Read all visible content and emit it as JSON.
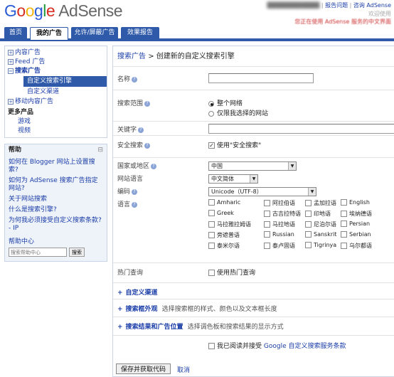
{
  "header": {
    "logo_google": [
      "G",
      "o",
      "o",
      "g",
      "l",
      "e"
    ],
    "logo_product": "AdSense",
    "userbar_account": "████████████",
    "userbar_links": [
      "报告问题",
      "咨询",
      "AdSense"
    ],
    "notice_line1": "欢迎使用",
    "notice_line2": "您正在使用 AdSense 服务的中文界面"
  },
  "tabs": [
    {
      "label": "首页"
    },
    {
      "label": "我的广告"
    },
    {
      "label": "允许/屏蔽广告"
    },
    {
      "label": "效果报告"
    }
  ],
  "sidebar": {
    "nav": [
      {
        "label": "内容广告",
        "icon": "+"
      },
      {
        "label": "Feed 广告",
        "icon": "+"
      },
      {
        "label": "搜索广告",
        "icon": "−"
      }
    ],
    "sub_selected": "自定义搜索引擎",
    "sub_other": "自定义渠道",
    "mobile": {
      "label": "移动内容广告",
      "icon": "+"
    },
    "more_title": "更多产品",
    "more_items": [
      "游戏",
      "视频"
    ],
    "help_title": "帮助",
    "help_min": "⊟",
    "help_links": [
      "如何在 Blogger 网站上设置搜索?",
      "如何为 AdSense 搜索广告指定网站?",
      "关于网站搜索",
      "什么是搜索引擎?",
      "为何我必须接受自定义搜索条款? - IP"
    ],
    "help_center": "帮助中心",
    "help_search_placeholder": "搜索帮助中心",
    "help_search_button": "搜索"
  },
  "main": {
    "crumb_link": "搜索广告",
    "crumb_sep": ">",
    "crumb_current": "创建新的自定义搜索引擎",
    "name_label": "名称",
    "scope_label": "搜索范围",
    "scope_options": [
      "整个网络",
      "仅限我选择的网站"
    ],
    "keywords_label": "关键字",
    "safesearch_label": "安全搜索",
    "safesearch_text": "使用\"安全搜索\"",
    "country_label": "国家或地区",
    "country_value": "中国",
    "site_lang_label": "网站语言",
    "site_lang_value": "中文简体",
    "encoding_label": "编码",
    "encoding_value": "Unicode（UTF-8）",
    "lang_label": "语言",
    "languages": [
      [
        "Amharic",
        "阿拉伯语",
        "孟加拉语",
        "English"
      ],
      [
        "Greek",
        "古吉拉特语",
        "印地语",
        "埃纳德语"
      ],
      [
        "马拉雅拉姆语",
        "马拉地语",
        "尼泊尔语",
        "Persian"
      ],
      [
        "旁遮普语",
        "Russian",
        "Sanskrit",
        "Serbian"
      ],
      [
        "泰米尔语",
        "泰卢固语",
        "Tigrinya",
        "乌尔都语"
      ]
    ],
    "popular_label": "热门查询",
    "popular_text": "使用热门查询",
    "sections": [
      {
        "title": "自定义渠道",
        "desc": ""
      },
      {
        "title": "搜索框外观",
        "desc": "选择搜索框的样式、颜色以及文本框长度"
      },
      {
        "title": "搜索结果和广告位置",
        "desc": "选择调色板和搜索结果的显示方式"
      }
    ],
    "section_icon": "+",
    "terms_prefix": "我已阅读并接受",
    "terms_link": "Google 自定义搜索服务条款",
    "save_button": "保存并获取代码",
    "cancel_link": "取消",
    "help_icon": "?"
  }
}
